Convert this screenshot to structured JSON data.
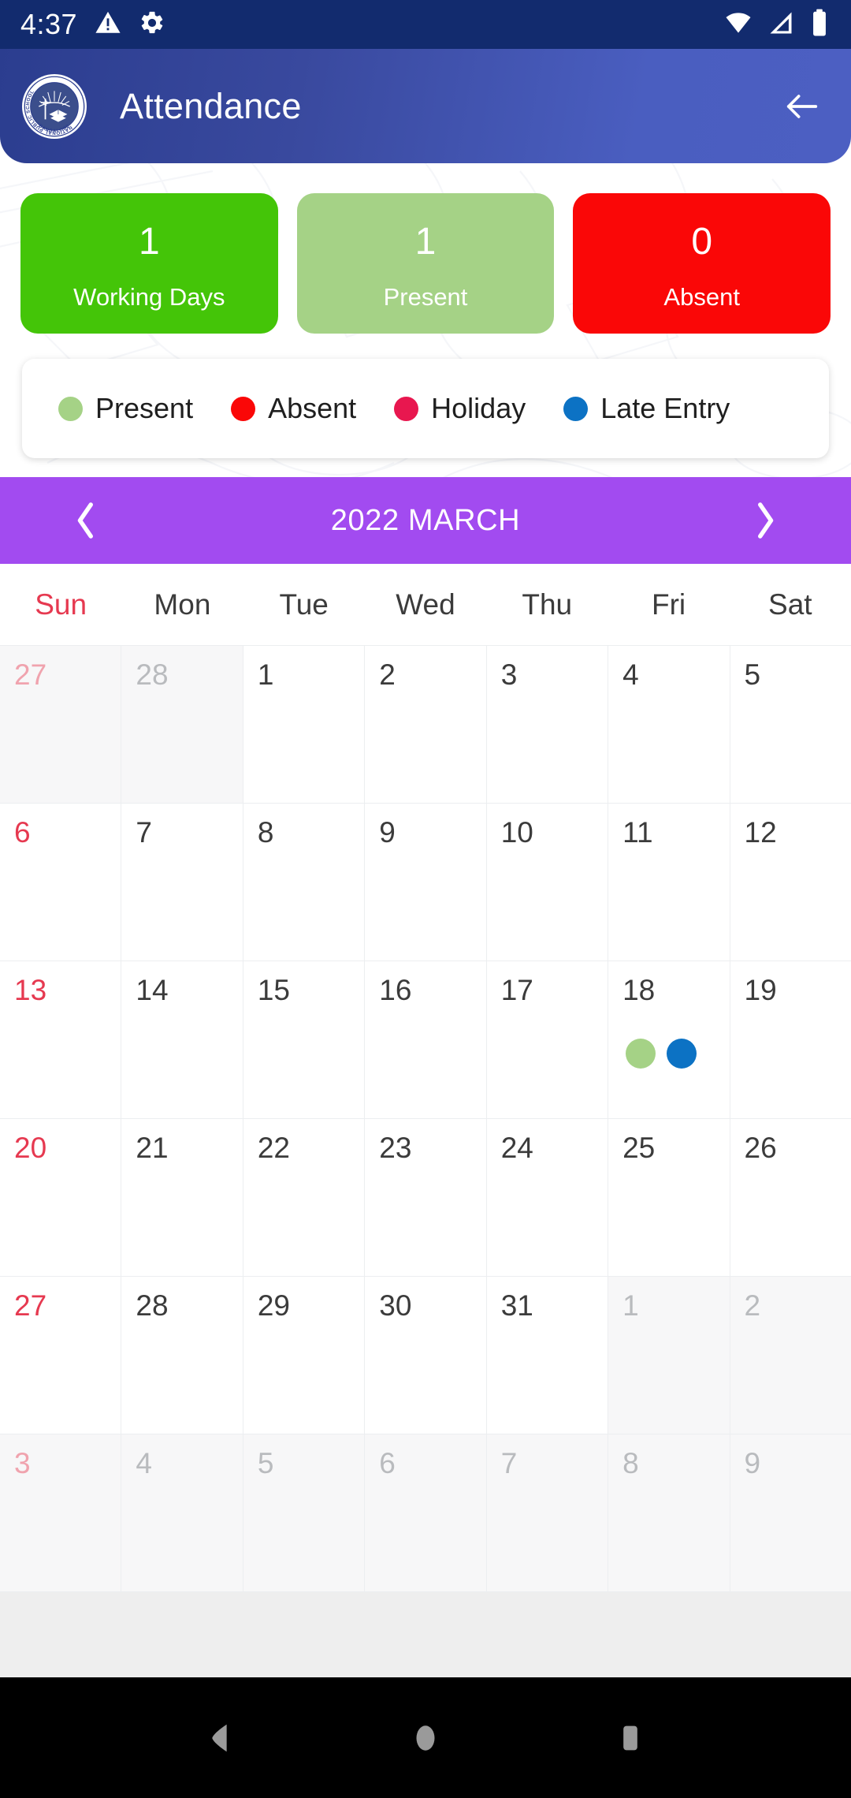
{
  "status_bar": {
    "time": "4:37",
    "left_icons": [
      "warning-icon",
      "gear-icon"
    ],
    "right_icons": [
      "wifi-icon",
      "cellular-signal-icon",
      "battery-icon"
    ],
    "background_color": "#122B6E"
  },
  "appbar": {
    "logo_name": "national-public-school-logo",
    "logo_text_top": "NATIONAL PUBLIC SCHOOL",
    "logo_text_bottom": "BANGALORE",
    "title": "Attendance",
    "back_icon": "back-arrow-icon",
    "gradient_from": "#2B3D8F",
    "gradient_to": "#4C5FC2"
  },
  "stats": [
    {
      "value": "1",
      "label": "Working Days",
      "color": "#44C508",
      "name": "working-days"
    },
    {
      "value": "1",
      "label": "Present",
      "color": "#A5D286",
      "name": "present"
    },
    {
      "value": "0",
      "label": "Absent",
      "color": "#FA0707",
      "name": "absent"
    }
  ],
  "legend": [
    {
      "label": "Present",
      "color": "#A5D286"
    },
    {
      "label": "Absent",
      "color": "#FA0707"
    },
    {
      "label": "Holiday",
      "color": "#E8174F"
    },
    {
      "label": "Late Entry",
      "color": "#0C72C4"
    }
  ],
  "month_nav": {
    "prev_icon": "chevron-left-icon",
    "next_icon": "chevron-right-icon",
    "title": "2022 MARCH",
    "background_color": "#A24BF0"
  },
  "weekdays": [
    {
      "label": "Sun",
      "highlight": true
    },
    {
      "label": "Mon",
      "highlight": false
    },
    {
      "label": "Tue",
      "highlight": false
    },
    {
      "label": "Wed",
      "highlight": false
    },
    {
      "label": "Thu",
      "highlight": false
    },
    {
      "label": "Fri",
      "highlight": false
    },
    {
      "label": "Sat",
      "highlight": false
    }
  ],
  "calendar": {
    "rows": [
      [
        {
          "day": "27",
          "out": true,
          "sun": true,
          "dots": []
        },
        {
          "day": "28",
          "out": true,
          "sun": false,
          "dots": []
        },
        {
          "day": "1",
          "out": false,
          "sun": false,
          "dots": []
        },
        {
          "day": "2",
          "out": false,
          "sun": false,
          "dots": []
        },
        {
          "day": "3",
          "out": false,
          "sun": false,
          "dots": []
        },
        {
          "day": "4",
          "out": false,
          "sun": false,
          "dots": []
        },
        {
          "day": "5",
          "out": false,
          "sun": false,
          "dots": []
        }
      ],
      [
        {
          "day": "6",
          "out": false,
          "sun": true,
          "dots": []
        },
        {
          "day": "7",
          "out": false,
          "sun": false,
          "dots": []
        },
        {
          "day": "8",
          "out": false,
          "sun": false,
          "dots": []
        },
        {
          "day": "9",
          "out": false,
          "sun": false,
          "dots": []
        },
        {
          "day": "10",
          "out": false,
          "sun": false,
          "dots": []
        },
        {
          "day": "11",
          "out": false,
          "sun": false,
          "dots": []
        },
        {
          "day": "12",
          "out": false,
          "sun": false,
          "dots": []
        }
      ],
      [
        {
          "day": "13",
          "out": false,
          "sun": true,
          "dots": []
        },
        {
          "day": "14",
          "out": false,
          "sun": false,
          "dots": []
        },
        {
          "day": "15",
          "out": false,
          "sun": false,
          "dots": []
        },
        {
          "day": "16",
          "out": false,
          "sun": false,
          "dots": []
        },
        {
          "day": "17",
          "out": false,
          "sun": false,
          "dots": []
        },
        {
          "day": "18",
          "out": false,
          "sun": false,
          "dots": [
            "#A5D286",
            "#0C72C4"
          ]
        },
        {
          "day": "19",
          "out": false,
          "sun": false,
          "dots": []
        }
      ],
      [
        {
          "day": "20",
          "out": false,
          "sun": true,
          "dots": []
        },
        {
          "day": "21",
          "out": false,
          "sun": false,
          "dots": []
        },
        {
          "day": "22",
          "out": false,
          "sun": false,
          "dots": []
        },
        {
          "day": "23",
          "out": false,
          "sun": false,
          "dots": []
        },
        {
          "day": "24",
          "out": false,
          "sun": false,
          "dots": []
        },
        {
          "day": "25",
          "out": false,
          "sun": false,
          "dots": []
        },
        {
          "day": "26",
          "out": false,
          "sun": false,
          "dots": []
        }
      ],
      [
        {
          "day": "27",
          "out": false,
          "sun": true,
          "dots": []
        },
        {
          "day": "28",
          "out": false,
          "sun": false,
          "dots": []
        },
        {
          "day": "29",
          "out": false,
          "sun": false,
          "dots": []
        },
        {
          "day": "30",
          "out": false,
          "sun": false,
          "dots": []
        },
        {
          "day": "31",
          "out": false,
          "sun": false,
          "dots": []
        },
        {
          "day": "1",
          "out": true,
          "sun": false,
          "dots": []
        },
        {
          "day": "2",
          "out": true,
          "sun": false,
          "dots": []
        }
      ],
      [
        {
          "day": "3",
          "out": true,
          "sun": true,
          "dots": []
        },
        {
          "day": "4",
          "out": true,
          "sun": false,
          "dots": []
        },
        {
          "day": "5",
          "out": true,
          "sun": false,
          "dots": []
        },
        {
          "day": "6",
          "out": true,
          "sun": false,
          "dots": []
        },
        {
          "day": "7",
          "out": true,
          "sun": false,
          "dots": []
        },
        {
          "day": "8",
          "out": true,
          "sun": false,
          "dots": []
        },
        {
          "day": "9",
          "out": true,
          "sun": false,
          "dots": []
        }
      ]
    ]
  },
  "nav_bar": {
    "back_icon": "android-back-icon",
    "home_icon": "android-home-icon",
    "recents_icon": "android-recents-icon"
  }
}
